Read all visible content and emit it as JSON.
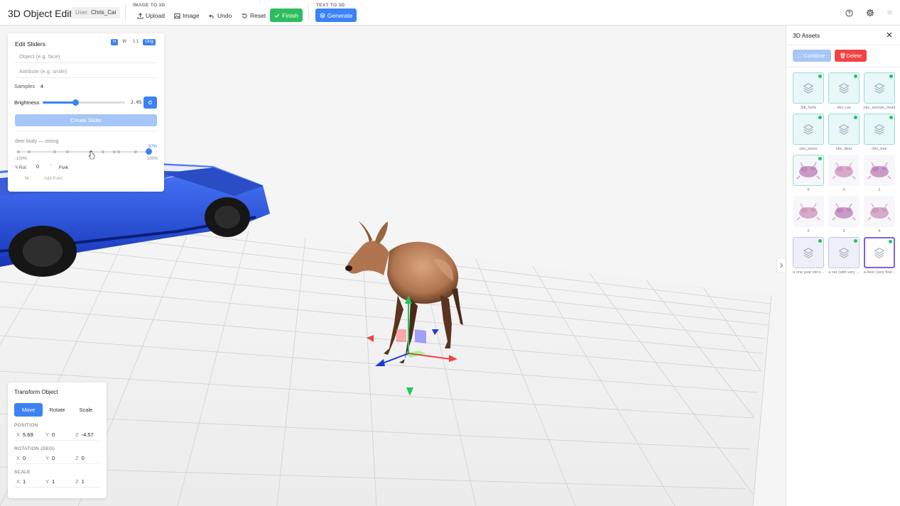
{
  "app": {
    "title": "3D Object Editor",
    "user_label": "User:",
    "user_name": "Chris_Cai"
  },
  "toolbar": {
    "image_to_3d_label": "IMAGE TO 3D",
    "text_to_3d_label": "TEXT TO 3D",
    "upload": "Upload",
    "image": "Image",
    "undo": "Undo",
    "reset": "Reset",
    "finish": "Finish",
    "generate": "Generate"
  },
  "sliders_panel": {
    "title": "Edit Sliders",
    "mode_buttons": [
      "H",
      "W",
      "1:1",
      "Orig"
    ],
    "object_placeholder": "Object (e.g. face)",
    "attribute_placeholder": "Attribute (e.g. smile)",
    "samples_label": "Samples",
    "samples_value": "4",
    "brightness_label": "Brightness",
    "brightness_value": "2.05",
    "brightness_fraction": 0.4,
    "create_slider": "Create Slider",
    "slider_name": "deer body — strong",
    "slider_percent": "97%",
    "slider_fraction": 0.97,
    "min_label": "-100%",
    "max_label": "100%",
    "yrot_label": "Y-Rot",
    "yrot_value": "0",
    "degree_symbol": "°",
    "fork_label": "Fork",
    "percent_symbol": "%",
    "add_point_label": "Add Point"
  },
  "transform_panel": {
    "title": "Transform Object",
    "modes": [
      "Move",
      "Rotate",
      "Scale"
    ],
    "active_mode": "Move",
    "position_label": "POSITION",
    "rotation_label": "ROTATION (DEG)",
    "scale_label": "SCALE",
    "position": {
      "x": "5.69",
      "y": "0",
      "z": "-4.57"
    },
    "rotation": {
      "x": "0",
      "y": "0",
      "z": "0"
    },
    "scale": {
      "x": "1",
      "y": "1",
      "z": "1"
    },
    "axis_x": "X",
    "axis_y": "Y",
    "axis_z": "Z"
  },
  "assets_panel": {
    "title": "3D Assets",
    "combine": "Combine",
    "delete": "Delete",
    "items": [
      {
        "caption": "3dl_Sofa",
        "style": "cyan",
        "dot": true
      },
      {
        "caption": "obv_car",
        "style": "cyan",
        "dot": true
      },
      {
        "caption": "obv_woman_head",
        "style": "cyan",
        "dot": true
      },
      {
        "caption": "obv_piano",
        "style": "cyan",
        "dot": true
      },
      {
        "caption": "obv_deer",
        "style": "cyan",
        "dot": true
      },
      {
        "caption": "obv_tree",
        "style": "cyan",
        "dot": true
      },
      {
        "caption": "5",
        "style": "selgreen",
        "dot": true
      },
      {
        "caption": "0",
        "style": "plain",
        "dot": false
      },
      {
        "caption": "1",
        "style": "plain",
        "dot": false
      },
      {
        "caption": "2",
        "style": "plain",
        "dot": false
      },
      {
        "caption": "3",
        "style": "plain",
        "dot": false
      },
      {
        "caption": "4",
        "style": "plain",
        "dot": false
      },
      {
        "caption": "a one year old s...",
        "style": "purple",
        "dot": true
      },
      {
        "caption": "a car (with very ...",
        "style": "purple",
        "dot": true
      },
      {
        "caption": "a deer (very fine...",
        "style": "sel",
        "dot": true
      }
    ]
  },
  "colors": {
    "accent": "#3b82f6",
    "success": "#2ebd5e",
    "danger": "#ef4444"
  }
}
